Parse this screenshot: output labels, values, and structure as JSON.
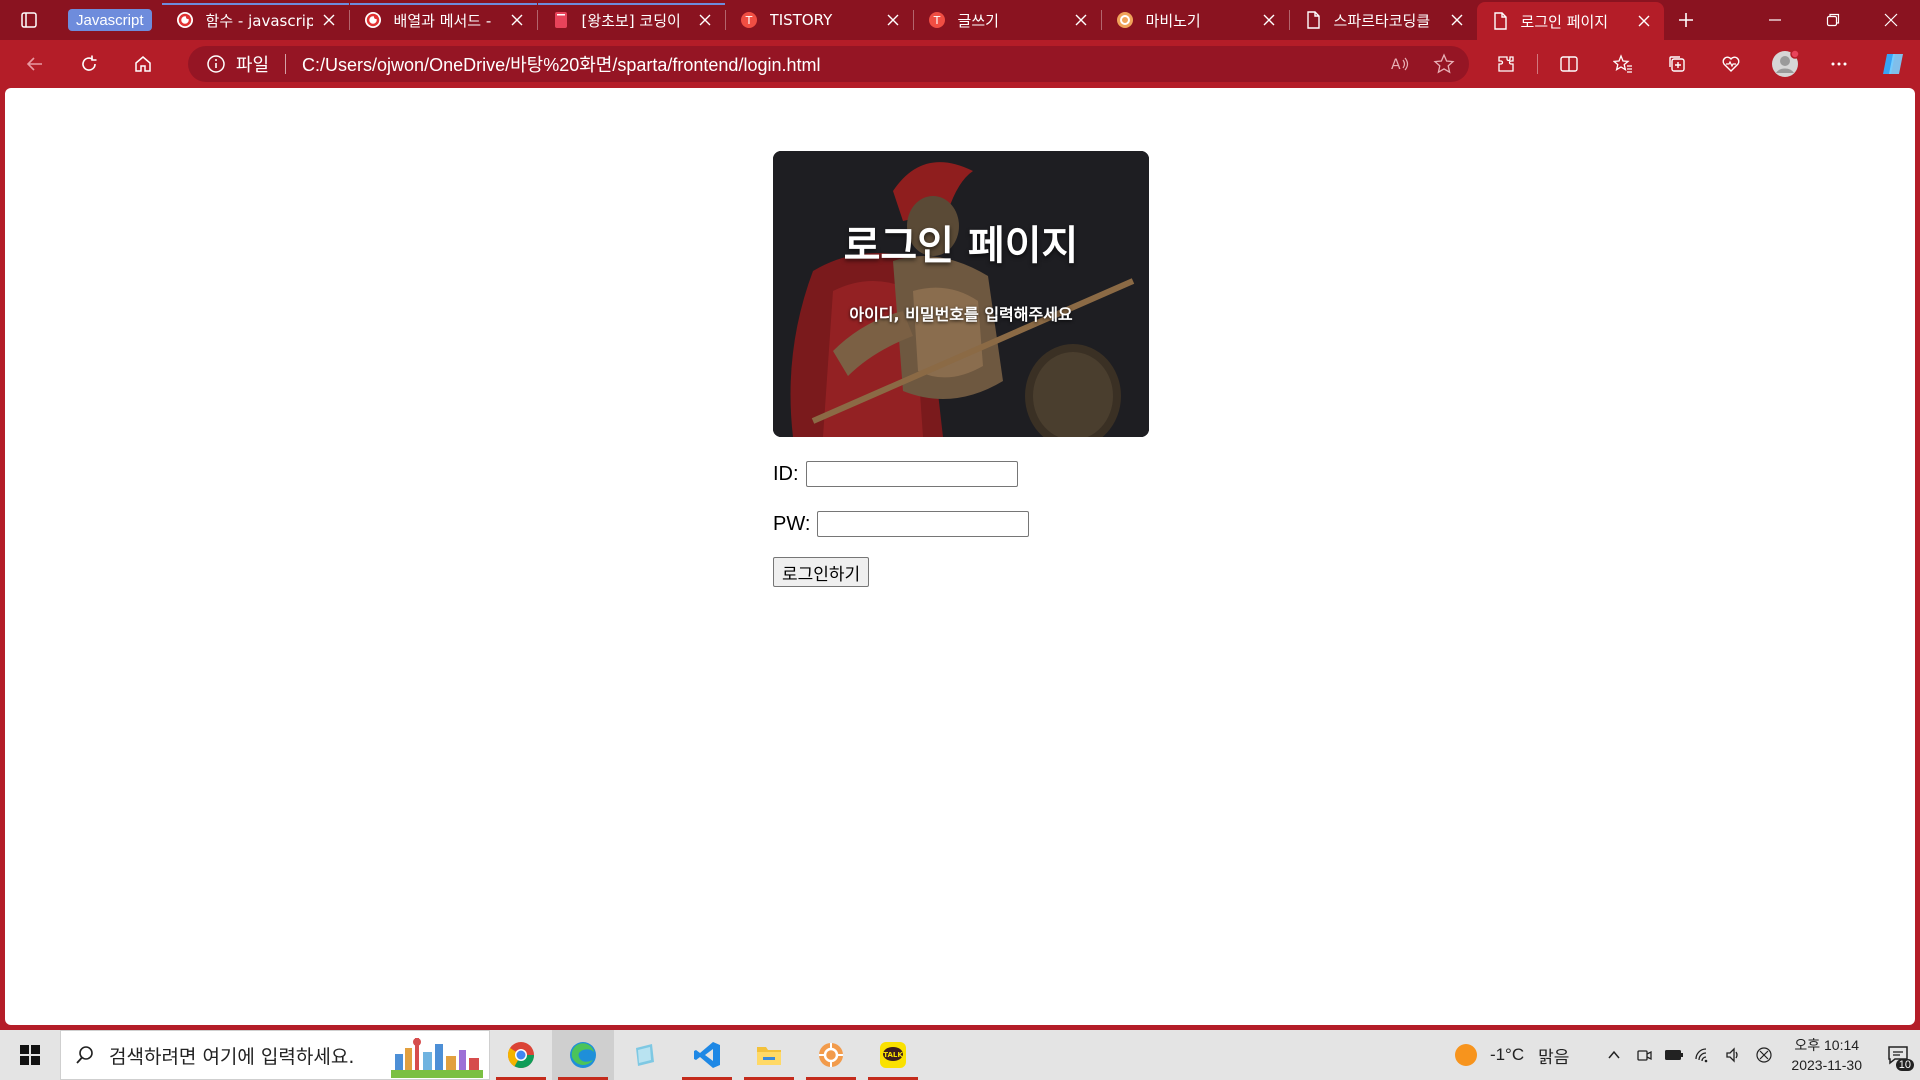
{
  "browser": {
    "tab_group_label": "Javascript",
    "tabs": [
      {
        "title": "함수 - javascript",
        "favicon": "velog-icon",
        "grouped": true,
        "active": false
      },
      {
        "title": "배열과 메서드 -",
        "favicon": "velog-icon",
        "grouped": true,
        "active": false
      },
      {
        "title": "[왕초보] 코딩이",
        "favicon": "book-icon",
        "grouped": true,
        "active": false
      },
      {
        "title": "TISTORY",
        "favicon": "tistory-icon",
        "grouped": false,
        "active": false
      },
      {
        "title": "글쓰기",
        "favicon": "tistory-icon",
        "grouped": false,
        "active": false
      },
      {
        "title": "마비노기",
        "favicon": "mabinogi-icon",
        "grouped": false,
        "active": false
      },
      {
        "title": "스파르타코딩클",
        "favicon": "page-icon",
        "grouped": false,
        "active": false
      },
      {
        "title": "로그인 페이지",
        "favicon": "page-icon",
        "grouped": false,
        "active": true
      }
    ],
    "address": {
      "site_info_label": "파일",
      "url": "C:/Users/ojwon/OneDrive/바탕%20화면/sparta/frontend/login.html"
    },
    "colors": {
      "frame": "#8a1320",
      "toolbar": "#b41d28",
      "group": "#6e8cdc"
    }
  },
  "page": {
    "banner_title": "로그인 페이지",
    "banner_subtitle": "아이디, 비밀번호를 입력해주세요",
    "id_label": "ID:",
    "id_value": "",
    "pw_label": "PW:",
    "pw_value": "",
    "login_button": "로그인하기"
  },
  "taskbar": {
    "search_placeholder": "검색하려면 여기에 입력하세요.",
    "apps": [
      "chrome-icon",
      "edge-icon",
      "notes-icon",
      "vscode-icon",
      "file-explorer-icon",
      "mabinogi-launcher-icon",
      "kakaotalk-icon"
    ],
    "weather": {
      "temp": "-1°C",
      "condition": "맑음"
    },
    "clock": {
      "time": "오후 10:14",
      "date": "2023-11-30"
    },
    "notification_count": "10"
  }
}
